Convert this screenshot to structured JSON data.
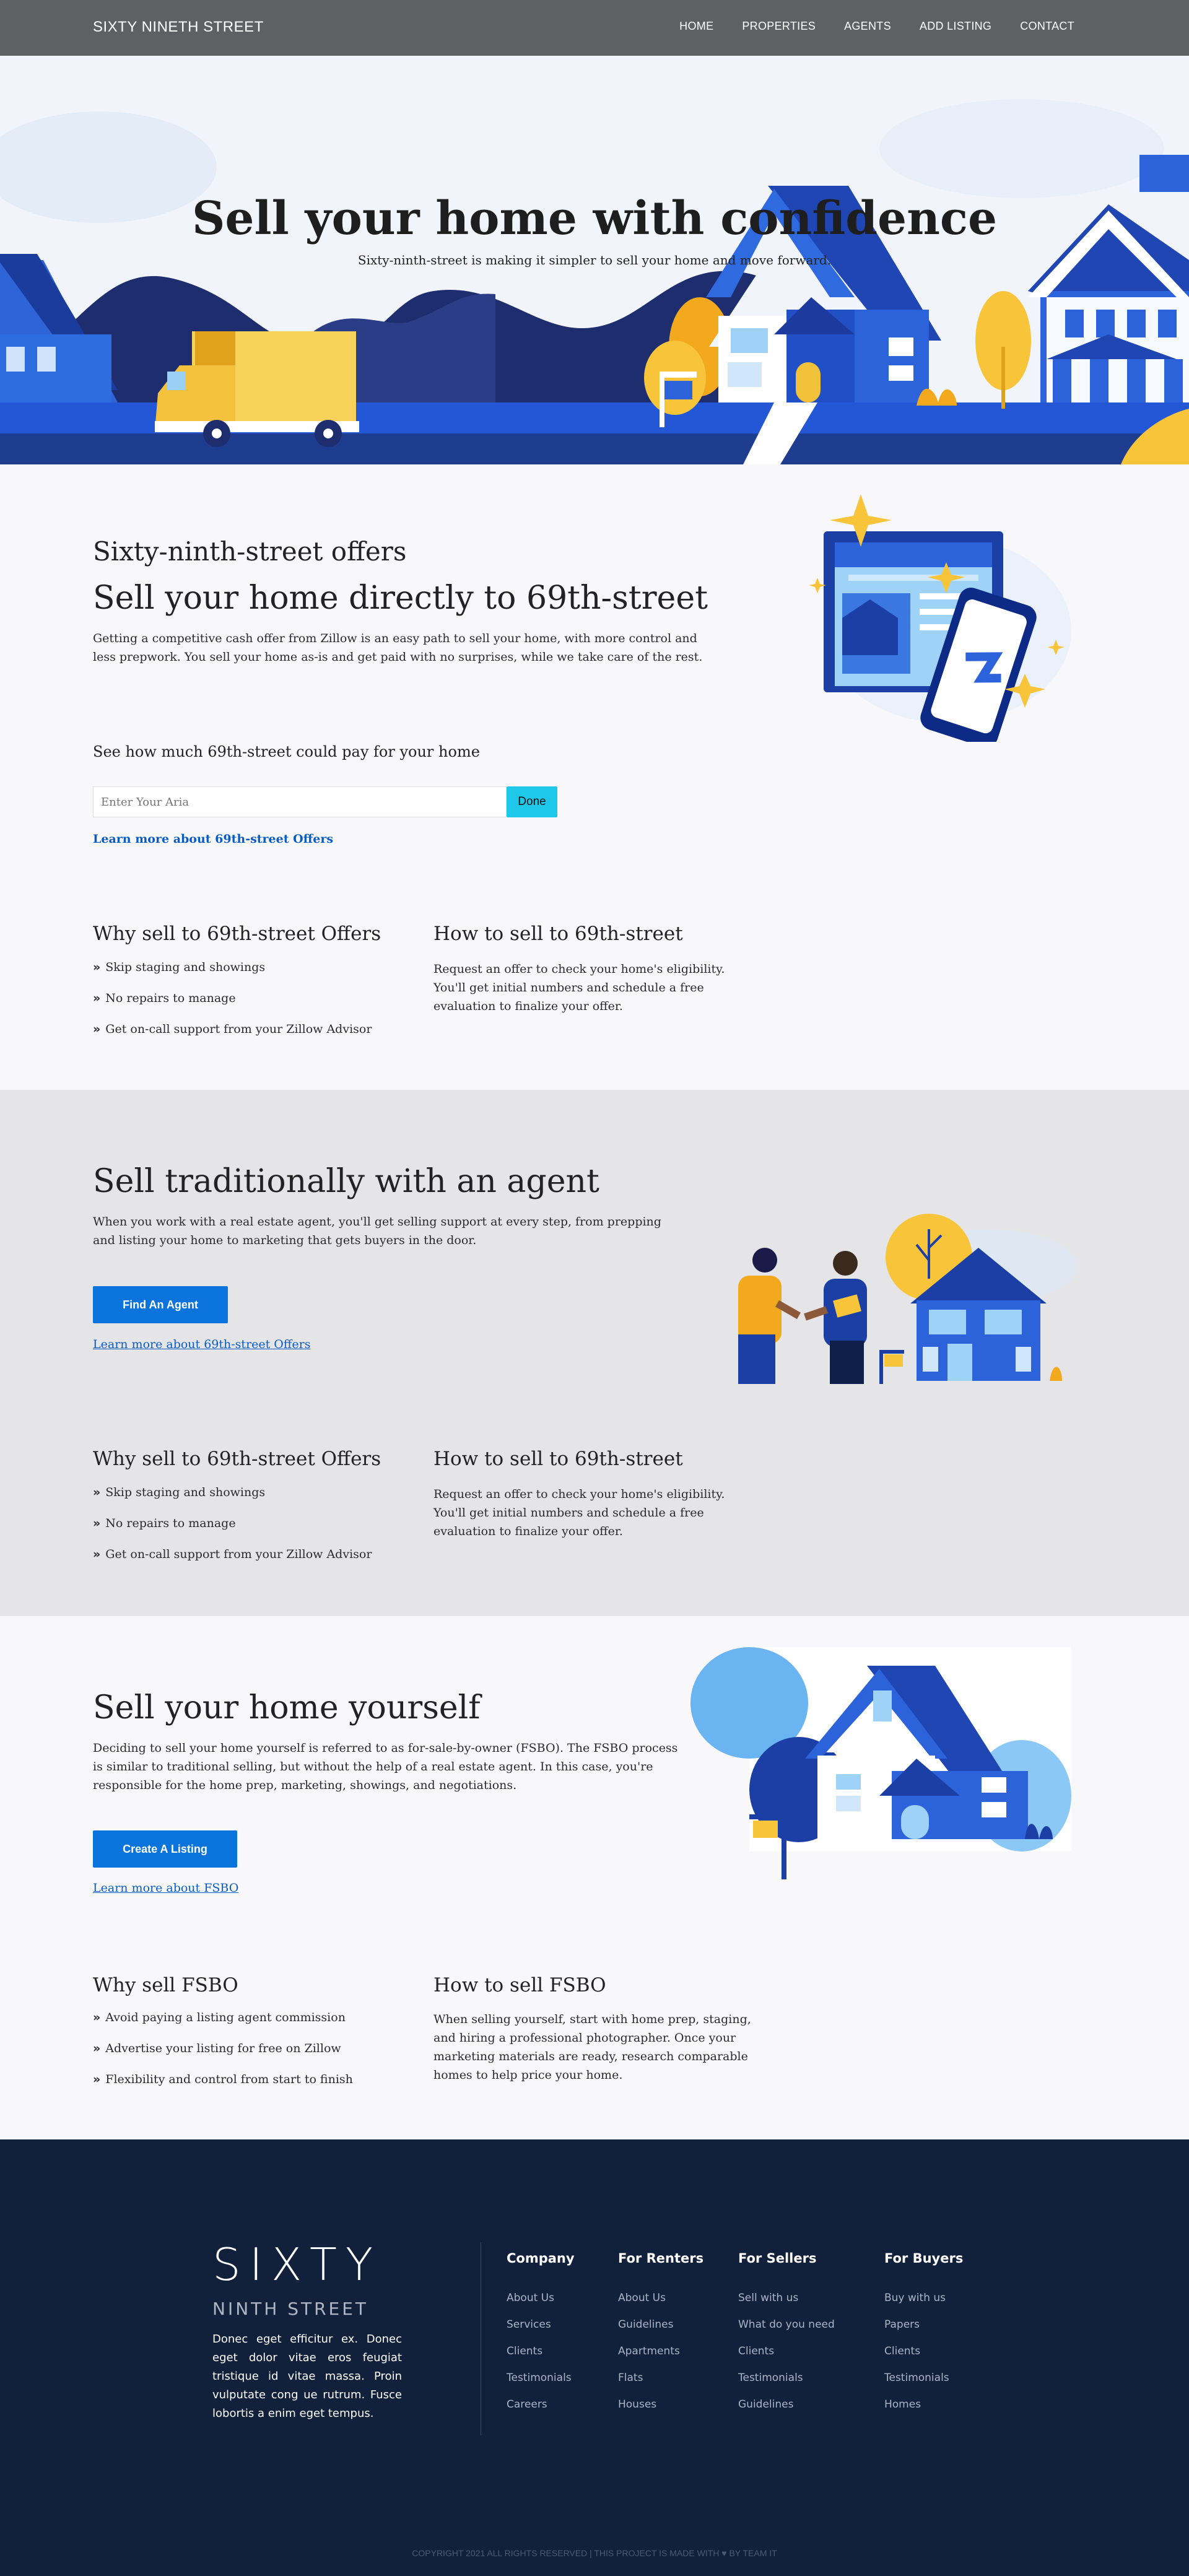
{
  "nav": {
    "brand": "SIXTY NINETH STREET",
    "links": [
      "HOME",
      "PROPERTIES",
      "AGENTS",
      "ADD LISTING",
      "CONTACT"
    ]
  },
  "hero": {
    "title": "Sell your home with confidence",
    "subtitle": "Sixty-ninth-street is making it simpler to sell your home and move forward."
  },
  "offers": {
    "eyebrow": "Sixty-ninth-street offers",
    "title": "Sell your home directly to 69th-street",
    "body": "Getting a competitive cash offer from Zillow is an easy path to sell your home, with more control and less prepwork. You sell your home as-is and get paid with no surprises, while we take care of the rest.",
    "calc_title": "See how much 69th-street could pay for your home",
    "input_placeholder": "Enter Your Aria",
    "done_label": "Done",
    "learn_more": "Learn more about 69th-street Offers",
    "why_title": "Why sell to 69th-street Offers",
    "why_items": [
      "Skip staging and showings",
      "No repairs to manage",
      "Get on-call support from your Zillow Advisor"
    ],
    "how_title": "How to sell to 69th-street",
    "how_body": "Request an offer to check your home's eligibility. You'll get initial numbers and schedule a free evaluation to finalize your offer."
  },
  "agent": {
    "title": "Sell traditionally with an agent",
    "body": "When you work with a real estate agent, you'll get selling support at every step, from prepping and listing your home to marketing that gets buyers in the door.",
    "button": "Find An Agent",
    "learn_more": "Learn more about 69th-street Offers",
    "why_title": "Why sell to 69th-street Offers",
    "why_items": [
      "Skip staging and showings",
      "No repairs to manage",
      "Get on-call support from your Zillow Advisor"
    ],
    "how_title": "How to sell to 69th-street",
    "how_body": "Request an offer to check your home's eligibility. You'll get initial numbers and schedule a free evaluation to finalize your offer."
  },
  "fsbo": {
    "title": "Sell your home yourself",
    "body": "Deciding to sell your home yourself is referred to as for-sale-by-owner (FSBO). The FSBO process is similar to traditional selling, but without the help of a real estate agent. In this case, you're responsible for the home prep, marketing, showings, and negotiations.",
    "button": "Create A Listing",
    "learn_more": "Learn more about FSBO",
    "why_title": "Why sell FSBO",
    "why_items": [
      "Avoid paying a listing agent commission",
      "Advertise your listing for free on Zillow",
      "Flexibility and control from start to finish"
    ],
    "how_title": "How to sell FSBO",
    "how_body": "When selling yourself, start with home prep, staging, and hiring a professional photographer. Once your marketing materials are ready, research comparable homes to help price your home."
  },
  "footer": {
    "logo": "SIXTY",
    "logo_sub": "NINTH STREET",
    "description": "Donec eget efficitur ex. Donec eget dolor vitae eros feugiat tristique id vitae massa. Proin vulputate cong ue rutrum. Fusce lobortis a enim eget tempus.",
    "columns": [
      {
        "title": "Company",
        "links": [
          "About Us",
          "Services",
          "Clients",
          "Testimonials",
          "Careers"
        ]
      },
      {
        "title": "For Renters",
        "links": [
          "About Us",
          "Guidelines",
          "Apartments",
          "Flats",
          "Houses"
        ]
      },
      {
        "title": "For Sellers",
        "links": [
          "Sell with us",
          "What do you need",
          "Clients",
          "Testimonials",
          "Guidelines"
        ]
      },
      {
        "title": "For Buyers",
        "links": [
          "Buy with us",
          "Papers",
          "Clients",
          "Testimonials",
          "Homes"
        ]
      }
    ],
    "copyright": "COPYRIGHT 2021 ALL RIGHTS RESERVED | THIS PROJECT IS MADE WITH ♥ BY TEAM IT"
  }
}
